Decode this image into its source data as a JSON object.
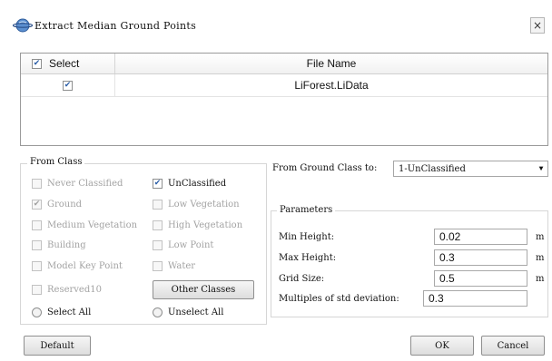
{
  "window": {
    "title": "Extract Median Ground Points",
    "close": "×"
  },
  "grid": {
    "columns": {
      "select": "Select",
      "file": "File Name"
    },
    "header_checked": true,
    "rows": [
      {
        "checked": true,
        "file": "LiForest.LiData"
      }
    ]
  },
  "from_class": {
    "title": "From Class",
    "items": [
      {
        "label": "Never Classified",
        "checked": false,
        "enabled": false
      },
      {
        "label": "UnClassified",
        "checked": true,
        "enabled": true
      },
      {
        "label": "Ground",
        "checked": true,
        "enabled": false
      },
      {
        "label": "Low Vegetation",
        "checked": false,
        "enabled": false
      },
      {
        "label": "Medium Vegetation",
        "checked": false,
        "enabled": false
      },
      {
        "label": "High Vegetation",
        "checked": false,
        "enabled": false
      },
      {
        "label": "Building",
        "checked": false,
        "enabled": false
      },
      {
        "label": "Low Point",
        "checked": false,
        "enabled": false
      },
      {
        "label": "Model Key Point",
        "checked": false,
        "enabled": false
      },
      {
        "label": "Water",
        "checked": false,
        "enabled": false
      },
      {
        "label": "Reserved10",
        "checked": false,
        "enabled": false
      }
    ],
    "other_classes": "Other Classes",
    "select_all": "Select All",
    "unselect_all": "Unselect All"
  },
  "to_class": {
    "label": "From Ground Class to:",
    "value": "1-UnClassified"
  },
  "parameters": {
    "title": "Parameters",
    "fields": [
      {
        "label": "Min Height:",
        "value": "0.02",
        "unit": "m"
      },
      {
        "label": "Max Height:",
        "value": "0.3",
        "unit": "m"
      },
      {
        "label": "Grid Size:",
        "value": "0.5",
        "unit": "m"
      },
      {
        "label": "Multiples of std deviation:",
        "value": "0.3",
        "unit": ""
      }
    ]
  },
  "buttons": {
    "default": "Default",
    "ok": "OK",
    "cancel": "Cancel"
  }
}
